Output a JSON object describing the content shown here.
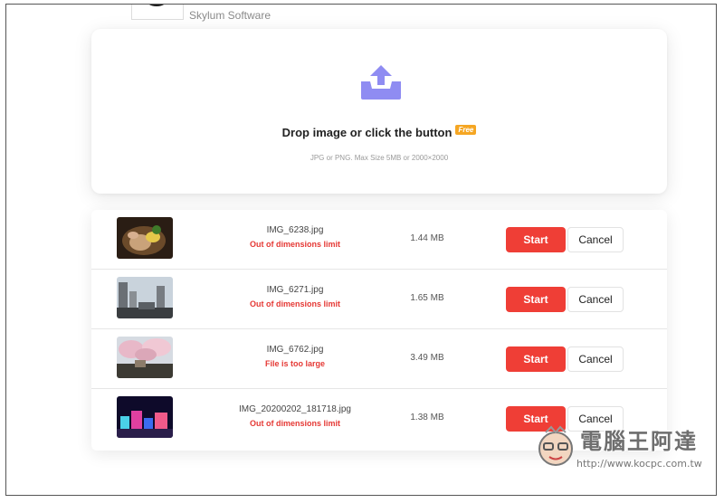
{
  "app": {
    "vendor": "Skylum Software"
  },
  "dropzone": {
    "title": "Drop image or click the button",
    "badge": "Free",
    "hint": "JPG or PNG. Max Size 5MB or 2000×2000"
  },
  "files": [
    {
      "name": "IMG_6238.jpg",
      "error": "Out of dimensions limit",
      "size": "1.44 MB",
      "start_label": "Start",
      "cancel_label": "Cancel"
    },
    {
      "name": "IMG_6271.jpg",
      "error": "Out of dimensions limit",
      "size": "1.65 MB",
      "start_label": "Start",
      "cancel_label": "Cancel"
    },
    {
      "name": "IMG_6762.jpg",
      "error": "File is too large",
      "size": "3.49 MB",
      "start_label": "Start",
      "cancel_label": "Cancel"
    },
    {
      "name": "IMG_20200202_181718.jpg",
      "error": "Out of dimensions limit",
      "size": "1.38 MB",
      "start_label": "Start",
      "cancel_label": "Cancel"
    }
  ],
  "watermark": {
    "title": "電腦王阿達",
    "url": "http://www.kocpc.com.tw"
  },
  "colors": {
    "accent_purple": "#8f8cf2",
    "start_red": "#ef3e36",
    "error_red": "#e53935",
    "badge_orange": "#f5a623"
  }
}
